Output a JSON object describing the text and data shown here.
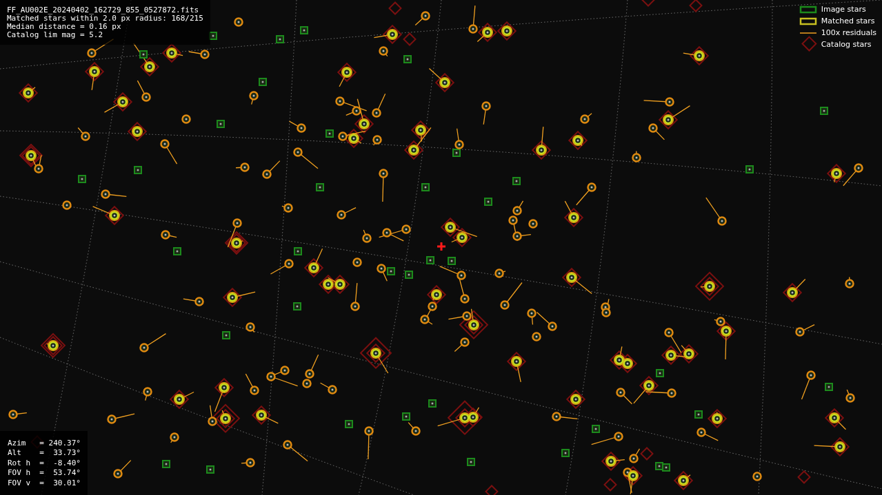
{
  "info_panel": {
    "lines": [
      "FF_AU002E_20240402_162729_855_0527872.fits",
      "Matched stars within 2.0 px radius: 168/215",
      "Median distance = 0.16 px",
      "Catalog lim mag = 5.2"
    ]
  },
  "legend": {
    "items": [
      {
        "kind": "image",
        "label": "Image stars"
      },
      {
        "kind": "matched",
        "label": "Matched stars"
      },
      {
        "kind": "residual",
        "label": "100x residuals"
      },
      {
        "kind": "catalog",
        "label": "Catalog stars"
      }
    ]
  },
  "pointing_panel": {
    "lines": [
      "Azim   = 240.37°",
      "Alt    =  33.73°",
      "Rot h  =  -8.40°",
      "FOV h  =  53.74°",
      "FOV v  =  30.01°"
    ]
  }
}
